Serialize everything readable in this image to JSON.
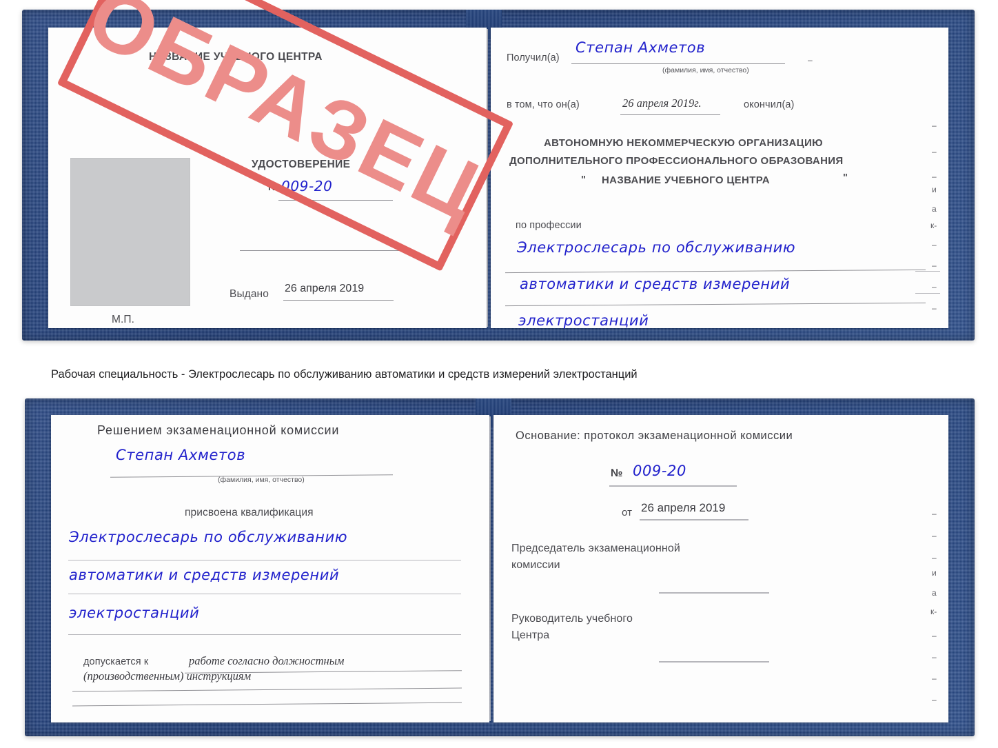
{
  "document": {
    "type": "certificate",
    "language": "ru"
  },
  "caption": {
    "text": "Рабочая специальность - Электрослесарь по обслуживанию автоматики и средств измерений электростанций"
  },
  "watermark": {
    "text": "ОБРАЗЕЦ",
    "color": "#e2625f"
  },
  "cover": {
    "color": "#23417c"
  },
  "certificate_top": {
    "left_page": {
      "center_name": "НАЗВАНИЕ УЧЕБНОГО ЦЕНТРА",
      "doc_title": "УДОСТОВЕРЕНИЕ",
      "number_label": "№",
      "number_value": "009-20",
      "issued_label": "Выдано",
      "issued_value": "26 апреля 2019",
      "seal_label": "М.П."
    },
    "right_page": {
      "received_label": "Получил(а)",
      "received_value": "Степан Ахметов",
      "fio_hint": "(фамилия, имя, отчество)",
      "in_that_label": "в том, что он(а)",
      "in_that_value": "26 апреля 2019г.",
      "finished_label": "окончил(а)",
      "org_line1": "АВТОНОМНУЮ НЕКОММЕРЧЕСКУЮ ОРГАНИЗАЦИЮ",
      "org_line2": "ДОПОЛНИТЕЛЬНОГО ПРОФЕССИОНАЛЬНОГО ОБРАЗОВАНИЯ",
      "org_quote_open": "\"",
      "org_line3": "НАЗВАНИЕ УЧЕБНОГО ЦЕНТРА",
      "org_quote_close": "\"",
      "profession_label": "по профессии",
      "profession_line1": "Электрослесарь по обслуживанию",
      "profession_line2": "автоматики и средств измерений",
      "profession_line3": "электростанций",
      "edge_fragments": [
        "–",
        "–",
        "–",
        "и",
        "а",
        "к-",
        "–",
        "–",
        "–",
        "–"
      ]
    }
  },
  "certificate_bottom": {
    "left_page": {
      "commission_title": "Решением экзаменационной комиссии",
      "name_value": "Степан Ахметов",
      "fio_hint": "(фамилия, имя, отчество)",
      "qualification_label": "присвоена квалификация",
      "qualification_line1": "Электрослесарь по обслуживанию",
      "qualification_line2": "автоматики и средств измерений",
      "qualification_line3": "электростанций",
      "admitted_label": "допускается к",
      "admitted_line1": "работе согласно должностным",
      "admitted_line2": "(производственным) инструкциям"
    },
    "right_page": {
      "basis_label": "Основание: протокол экзаменационной комиссии",
      "number_label": "№",
      "number_value": "009-20",
      "date_label": "от",
      "date_value": "26 апреля 2019",
      "chairman_line1": "Председатель экзаменационной",
      "chairman_line2": "комиссии",
      "head_line1": "Руководитель учебного",
      "head_line2": "Центра",
      "edge_fragments": [
        "–",
        "–",
        "и",
        "а",
        "к-",
        "–",
        "–",
        "–"
      ]
    }
  }
}
